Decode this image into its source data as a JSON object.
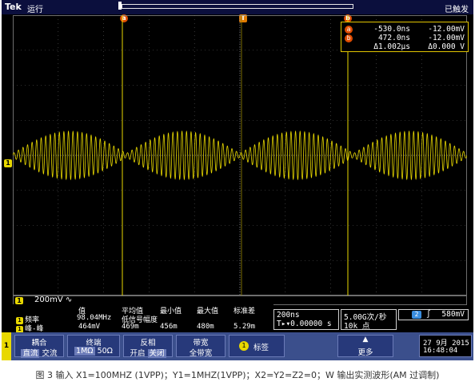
{
  "top": {
    "brand": "Tek",
    "state": "运行",
    "trigger_state": "已触发"
  },
  "markers": {
    "a": "a",
    "b": "b",
    "trigger": "T",
    "ch1": "1"
  },
  "cursors": {
    "a_time": "-530.0ns",
    "a_volt": "-12.00mV",
    "b_time": "472.0ns",
    "b_volt": "-12.00mV",
    "delta_time": "Δ1.002μs",
    "delta_volt": "Δ0.000 V"
  },
  "waveform": {
    "envelope_cycles": 4,
    "carrier_cycles": 100,
    "color": "#e8d800"
  },
  "ch1": {
    "badge": "1",
    "scale": "200mV ∿"
  },
  "measurements": {
    "headers": [
      "值",
      "平均值",
      "最小值",
      "最大值",
      "标准差"
    ],
    "rows": [
      {
        "badge": "1",
        "name": "频率",
        "value": "98.04MHz",
        "note": "低信号幅度",
        "mean": "",
        "min": "",
        "max": "",
        "std": ""
      },
      {
        "badge": "1",
        "name": "峰-峰",
        "value": "464mV",
        "note": "",
        "mean": "469m",
        "min": "456m",
        "max": "480m",
        "std": "5.29m"
      }
    ]
  },
  "timebase": {
    "scale": "200ns",
    "position": "T▸▾0.00000 s"
  },
  "acquisition": {
    "rate": "5.00G次/秒",
    "points": "10k 点"
  },
  "trigger": {
    "channel": "2",
    "slope": "∫",
    "level": "580mV"
  },
  "buttons": {
    "coupling": {
      "label": "耦合",
      "opt1": "直流",
      "opt2": "交流"
    },
    "termination": {
      "label": "终端",
      "opt1": "1MΩ",
      "opt2": "50Ω"
    },
    "invert": {
      "label": "反相",
      "opt1": "开启",
      "opt2": "关闭"
    },
    "bandwidth": {
      "label": "带宽",
      "value": "全带宽"
    },
    "label_btn": {
      "badge": "1",
      "label": "标签"
    },
    "more": {
      "label": "更多"
    },
    "ch_tab": "1"
  },
  "datetime": {
    "date": "27 9月 2015",
    "time": "16:48:04"
  },
  "caption": "图 3  输入 X1=100MHZ (1VPP)；Y1=1MHZ(1VPP)；X2=Y2=Z2=0；W 输出实测波形(AM 过调制)"
}
